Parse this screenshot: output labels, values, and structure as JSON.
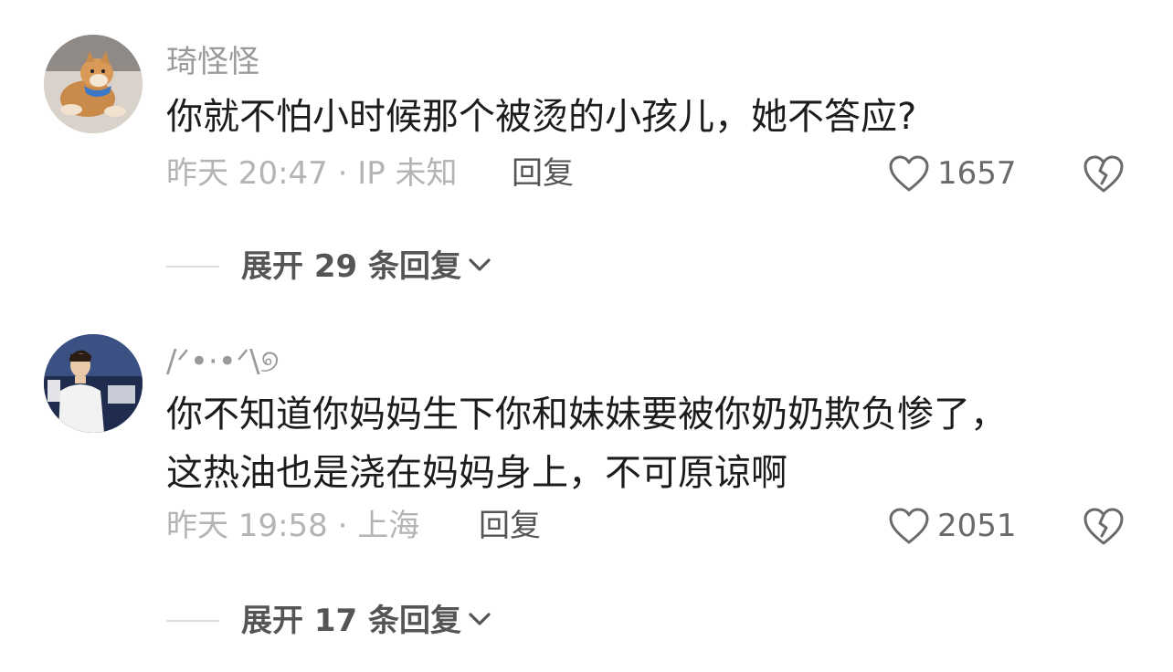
{
  "comments": [
    {
      "username": "琦怪怪",
      "avatar": "shiba-dog-avatar",
      "content_lines": [
        "你就不怕小时候那个被烫的小孩儿，她不答应?"
      ],
      "timestamp": "昨天 20:47 · IP 未知",
      "reply_label": "回复",
      "likes": "1657",
      "expand_label": "展开 29 条回复"
    },
    {
      "username": "/ᐟ•·•ᐟ\\୭",
      "avatar": "person-night-avatar",
      "content_lines": [
        "你不知道你妈妈生下你和妹妹要被你奶奶欺负惨了，",
        "这热油也是浇在妈妈身上，不可原谅啊"
      ],
      "timestamp": "昨天 19:58 · 上海",
      "reply_label": "回复",
      "likes": "2051",
      "expand_label": "展开 17 条回复"
    }
  ],
  "icons": {
    "like": "heart-outline-icon",
    "dislike": "broken-heart-icon",
    "expand": "chevron-down-icon"
  },
  "colors": {
    "text_primary": "#1c1c1c",
    "text_secondary": "#9a9a9a",
    "text_meta": "#b4b4b4",
    "action": "#555555"
  }
}
